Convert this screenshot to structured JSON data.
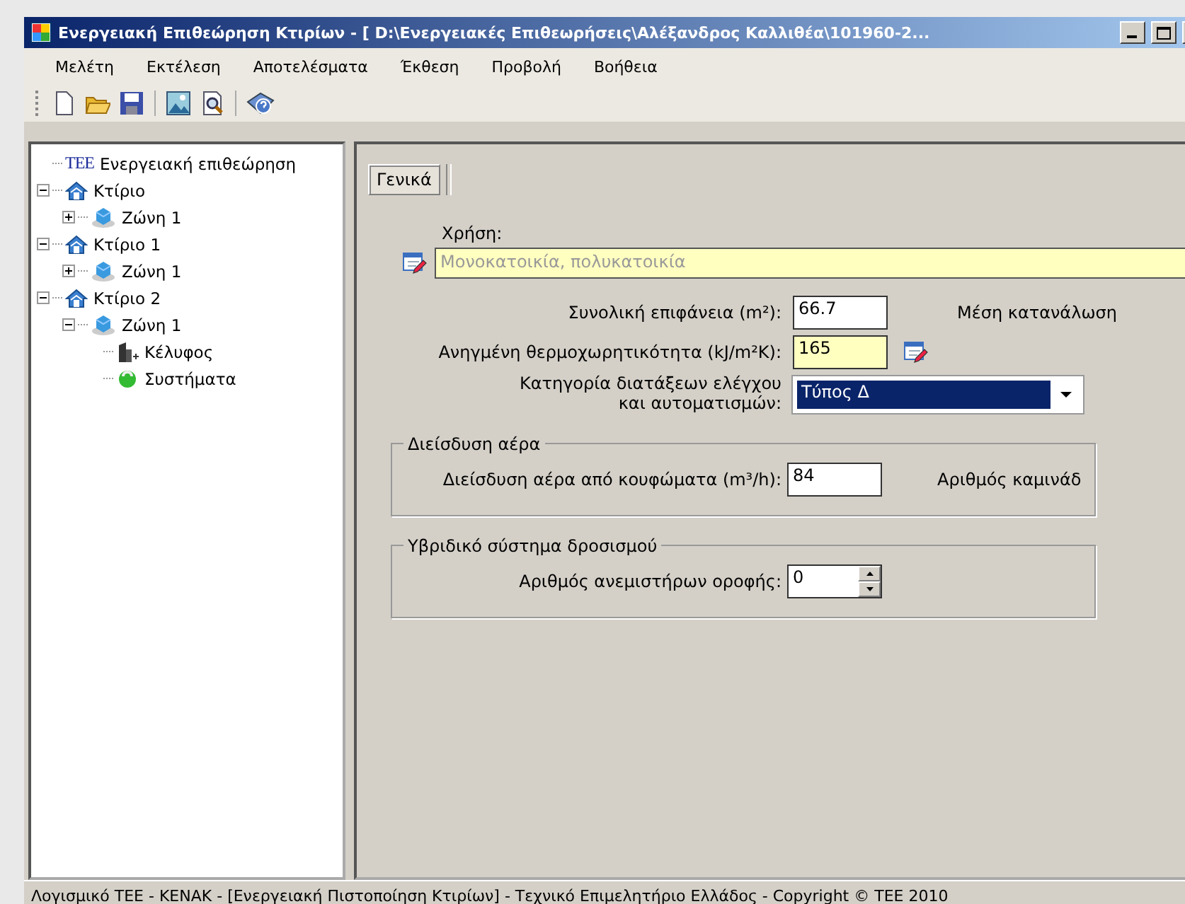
{
  "window": {
    "title": "Ενεργειακή Επιθεώρηση Κτιρίων - [ D:\\Ενεργειακές Επιθεωρήσεις\\Αλέξανδρος Καλλιθέα\\101960-2..."
  },
  "menu": [
    "Μελέτη",
    "Εκτέλεση",
    "Αποτελέσματα",
    "Έκθεση",
    "Προβολή",
    "Βοήθεια"
  ],
  "toolbar": [
    {
      "kind": "new"
    },
    {
      "kind": "open"
    },
    {
      "kind": "save"
    },
    {
      "kind": "separator"
    },
    {
      "kind": "image"
    },
    {
      "kind": "preview"
    },
    {
      "kind": "separator"
    },
    {
      "kind": "help"
    }
  ],
  "tree": [
    {
      "kind": "tee",
      "badge": "TEE",
      "label": "Ενεργειακή επιθεώρηση"
    },
    {
      "kind": "building",
      "label": "Κτίριο",
      "expanded": true,
      "children": [
        {
          "kind": "zone",
          "label": "Ζώνη 1",
          "expanded": false
        }
      ]
    },
    {
      "kind": "building",
      "label": "Κτίριο 1",
      "expanded": true,
      "children": [
        {
          "kind": "zone",
          "label": "Ζώνη 1",
          "expanded": false
        }
      ]
    },
    {
      "kind": "building",
      "label": "Κτίριο 2",
      "expanded": true,
      "children": [
        {
          "kind": "zone",
          "label": "Ζώνη 1",
          "expanded": true,
          "children": [
            {
              "kind": "shell",
              "label": "Κέλυφος"
            },
            {
              "kind": "systems",
              "label": "Συστήματα"
            }
          ]
        }
      ]
    }
  ],
  "tabs": [
    {
      "label": "Γενικά",
      "selected": true
    }
  ],
  "usage": {
    "label": "Χρήση:",
    "value": "Μονοκατοικία, πολυκατοικία",
    "disabled": true
  },
  "fields": [
    {
      "label": "Συνολική επιφάνεια (m²):",
      "value": "66.7",
      "highlighted": false,
      "side_label": "Μέση κατανάλωση"
    },
    {
      "label": "Ανηγμένη θερμοχωρητικότητα (kJ/m²K):",
      "value": "165",
      "highlighted": true,
      "edit_icon": true
    }
  ],
  "dropdown": {
    "label": "Κατηγορία διατάξεων ελέγχου\nκαι αυτοματισμών:",
    "value": "Τύπος Δ",
    "selected": true
  },
  "groups": [
    {
      "title": "Διείσδυση αέρα",
      "field": {
        "kind": "text",
        "label": "Διείσδυση αέρα από κουφώματα (m³/h):",
        "value": "84",
        "side_label": "Αριθμός καμινάδ"
      }
    },
    {
      "title": "Υβριδικό σύστημα δροσισμού",
      "field": {
        "kind": "spinner",
        "label": "Αριθμός ανεμιστήρων οροφής:",
        "value": "0"
      }
    }
  ],
  "status_bar": "Λογισμικό ΤΕΕ - ΚΕΝΑΚ  -  [Ενεργειακή Πιστοποίηση Κτιρίων]  -  Τεχνικό Επιμελητήριο Ελλάδος  -  Copyright © ΤΕΕ 2010"
}
